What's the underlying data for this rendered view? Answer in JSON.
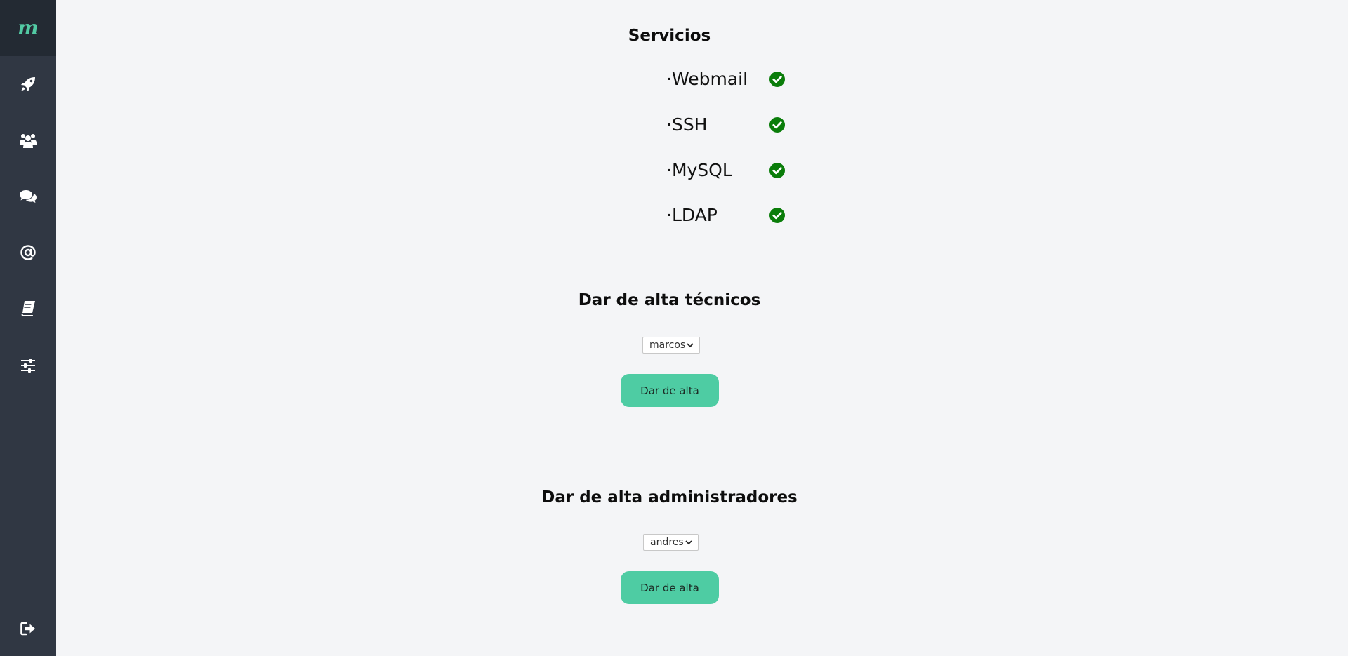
{
  "sidebar": {
    "logo": "m",
    "items": [
      {
        "icon": "rocket-icon"
      },
      {
        "icon": "users-icon"
      },
      {
        "icon": "comments-icon"
      },
      {
        "icon": "at-icon"
      },
      {
        "icon": "book-icon"
      },
      {
        "icon": "sliders-icon"
      }
    ],
    "logout_icon": "sign-out-icon"
  },
  "services": {
    "title": "Servicios",
    "items": [
      {
        "name": "·Webmail",
        "status": "ok"
      },
      {
        "name": "·SSH",
        "status": "ok"
      },
      {
        "name": "·MySQL",
        "status": "ok"
      },
      {
        "name": "·LDAP",
        "status": "ok"
      }
    ],
    "ok_color": "#0a7d0a"
  },
  "technicians": {
    "title": "Dar de alta técnicos",
    "select_value": "marcos",
    "button_label": "Dar de alta"
  },
  "admins": {
    "title": "Dar de alta administradores",
    "select_value": "andres",
    "button_label": "Dar de alta"
  },
  "colors": {
    "sidebar": "#303743",
    "sidebar_logo_bg": "#232a33",
    "accent": "#4ecca3",
    "background": "#f4f5f7"
  }
}
